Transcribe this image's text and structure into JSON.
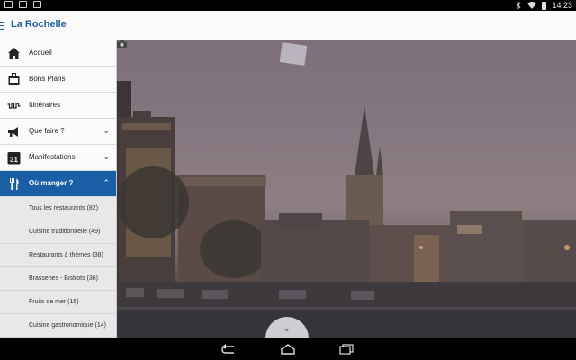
{
  "status_bar": {
    "time": "14:23"
  },
  "app_bar": {
    "title": "La Rochelle"
  },
  "sidebar": {
    "items": [
      {
        "label": "Accueil",
        "icon": "home-icon",
        "chevron": ""
      },
      {
        "label": "Bons Plans",
        "icon": "bons-plans-icon",
        "chevron": ""
      },
      {
        "label": "Itinéraires",
        "icon": "route-icon",
        "chevron": ""
      },
      {
        "label": "Que faire ?",
        "icon": "megaphone-icon",
        "chevron": "⌄"
      },
      {
        "label": "Manifestations",
        "icon": "calendar-icon",
        "chevron": "⌄"
      },
      {
        "label": "Où manger ?",
        "icon": "fork-knife-icon",
        "chevron": "⌃"
      }
    ],
    "subitems": [
      {
        "label": "Tous les restaurants (82)"
      },
      {
        "label": "Cuisine traditionnelle (49)"
      },
      {
        "label": "Restaurants à thèmes (38)"
      },
      {
        "label": "Brasseries - Bistrots (36)"
      },
      {
        "label": "Fruits de mer (15)"
      },
      {
        "label": "Cuisine gastronomique (14)"
      }
    ],
    "calendar_day": "31"
  },
  "hero": {
    "scroll_icon": "chevron-down-icon",
    "down_label": "⌄"
  },
  "colors": {
    "accent": "#1a5ea6",
    "title": "#1d5fa6"
  }
}
